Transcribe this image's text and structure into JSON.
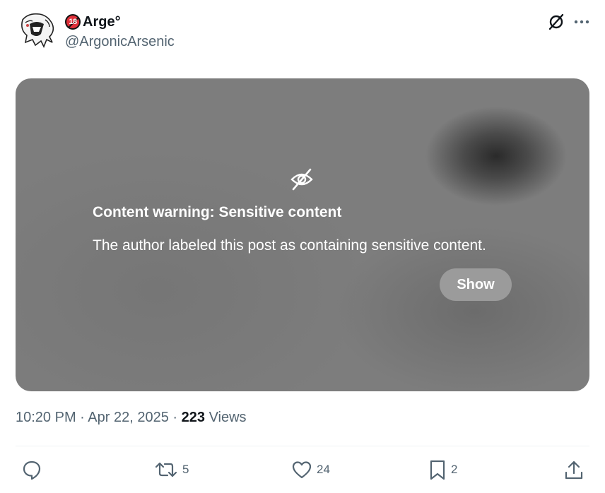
{
  "author": {
    "display_name": "Arge°",
    "handle": "@ArgonicArsenic",
    "badge_text": "18"
  },
  "header_icons": [
    "grok-icon",
    "more-icon"
  ],
  "media": {
    "warning_title": "Content warning: Sensitive content",
    "warning_description": "The author labeled this post as containing sensitive content.",
    "show_label": "Show"
  },
  "meta": {
    "time": "10:20 PM",
    "sep1": "·",
    "date": "Apr 22, 2025",
    "sep2": "·",
    "views_count": "223",
    "views_label": "Views"
  },
  "actions": {
    "reply_count": "",
    "retweet_count": "5",
    "like_count": "24",
    "bookmark_count": "2"
  }
}
